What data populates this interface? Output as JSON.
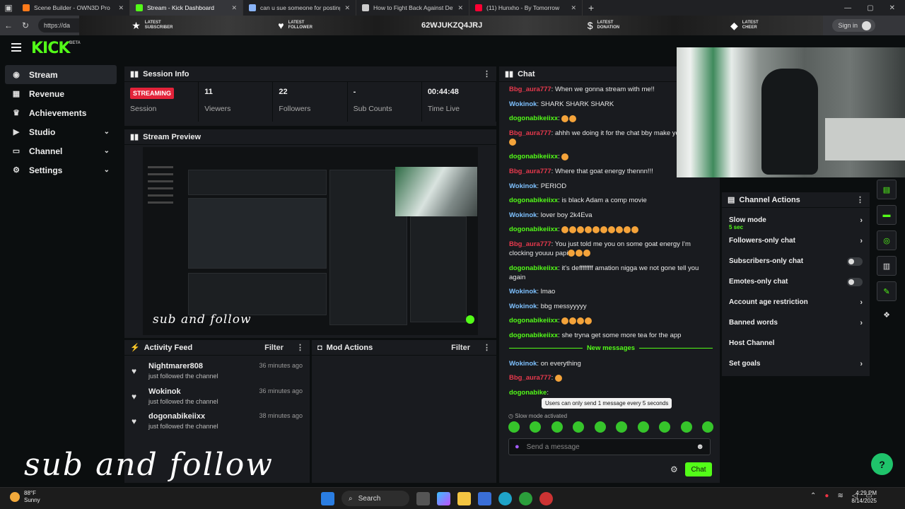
{
  "browser": {
    "tabs": [
      {
        "title": "Scene Builder - OWN3D Pro",
        "color": "#ff7a1a"
      },
      {
        "title": "Stream - Kick Dashboard",
        "color": "#53fc18"
      },
      {
        "title": "can u sue someone for posting y",
        "color": "#8ab4f8"
      },
      {
        "title": "How to Fight Back Against Defan",
        "color": "#cccccc"
      },
      {
        "title": "(11) Hunxho - By Tomorrow",
        "color": "#ff0033"
      }
    ],
    "url": "https://da",
    "signin": "Sign in"
  },
  "banner": {
    "items": [
      {
        "icon": "★",
        "label": "LATEST SUBSCRIBER"
      },
      {
        "icon": "♥",
        "label": "LATEST FOLLOWER"
      },
      {
        "icon": "$",
        "label": "LATEST DONATION"
      },
      {
        "icon": "◆",
        "label": "LATEST CHEER"
      }
    ],
    "code": "62WJUKZQ4JRJ"
  },
  "kick": {
    "logo": "KICK",
    "beta": "BETA"
  },
  "sidebar": {
    "items": [
      {
        "label": "Stream",
        "icon": "broadcast-icon",
        "glyph": "◉"
      },
      {
        "label": "Revenue",
        "icon": "chart-icon",
        "glyph": "▦"
      },
      {
        "label": "Achievements",
        "icon": "trophy-icon",
        "glyph": "♛"
      },
      {
        "label": "Studio",
        "icon": "video-icon",
        "glyph": "▶"
      },
      {
        "label": "Channel",
        "icon": "tv-icon",
        "glyph": "▭"
      },
      {
        "label": "Settings",
        "icon": "gear-icon",
        "glyph": "⚙"
      }
    ]
  },
  "session": {
    "title": "Session Info",
    "status": "STREAMING",
    "stats": [
      {
        "value": "",
        "label": "Session"
      },
      {
        "value": "11",
        "label": "Viewers"
      },
      {
        "value": "22",
        "label": "Followers"
      },
      {
        "value": "-",
        "label": "Sub Counts"
      },
      {
        "value": "00:44:48",
        "label": "Time Live"
      }
    ]
  },
  "preview": {
    "title": "Stream Preview",
    "caption": "sub and follow"
  },
  "activity": {
    "title": "Activity Feed",
    "filter": "Filter",
    "items": [
      {
        "name": "Nightmarer808",
        "action": "just followed the channel",
        "time": "36 minutes ago"
      },
      {
        "name": "Wokinok",
        "action": "just followed the channel",
        "time": "36 minutes ago"
      },
      {
        "name": "dogonabikeiixx",
        "action": "just followed the channel",
        "time": "38 minutes ago"
      }
    ]
  },
  "mod": {
    "title": "Mod Actions",
    "filter": "Filter"
  },
  "chat": {
    "title": "Chat",
    "messages": [
      {
        "user": "Bbg_aura777",
        "color": "red",
        "text": "When we gonna stream with me!!",
        "emotes": 0
      },
      {
        "user": "Wokinok",
        "color": "blue",
        "text": "SHARK SHARK SHARK",
        "emotes": 0
      },
      {
        "user": "dogonabikeiixx",
        "color": "green",
        "text": "",
        "emotes": 2
      },
      {
        "user": "Bbg_aura777",
        "color": "red",
        "text": "ahhh we doing it for the chat bby make you",
        "emotes": 4
      },
      {
        "user": "dogonabikeiixx",
        "color": "green",
        "text": "",
        "emotes": 1
      },
      {
        "user": "Bbg_aura777",
        "color": "red",
        "text": "Where that goat energy thennn!!!",
        "emotes": 0
      },
      {
        "user": "Wokinok",
        "color": "blue",
        "text": "PERIOD",
        "emotes": 0
      },
      {
        "user": "dogonabikeiixx",
        "color": "green",
        "text": "is black Adam a comp movie",
        "emotes": 0
      },
      {
        "user": "Wokinok",
        "color": "blue",
        "text": "lover boy 2k4Eva",
        "emotes": 0
      },
      {
        "user": "dogonabikeiixx",
        "color": "green",
        "text": "",
        "emotes": 10
      },
      {
        "user": "Bbg_aura777",
        "color": "red",
        "text": "You just told me you on some goat energy I'm clocking youuu papi",
        "emotes": 3
      },
      {
        "user": "dogonabikeiixx",
        "color": "green",
        "text": "it's deffffffff amation nigga we not gone tell you again",
        "emotes": 0
      },
      {
        "user": "Wokinok",
        "color": "blue",
        "text": "lmao",
        "emotes": 0
      },
      {
        "user": "Wokinok",
        "color": "blue",
        "text": "bbg messyyyyy",
        "emotes": 0
      },
      {
        "user": "dogonabikeiixx",
        "color": "green",
        "text": "",
        "emotes": 4
      },
      {
        "user": "dogonabikeiixx",
        "color": "green",
        "text": "she tryna get some more tea for the app",
        "emotes": 0
      }
    ],
    "divider": "New messages",
    "new_messages": [
      {
        "user": "Wokinok",
        "color": "blue",
        "text": "on everything",
        "emotes": 0
      },
      {
        "user": "Bbg_aura777",
        "color": "red",
        "text": "",
        "emotes": 1
      },
      {
        "user": "dogonabike",
        "color": "green",
        "text": "",
        "emotes": 0
      }
    ],
    "tooltip": "Users can only send 1 message every 5 seconds",
    "slow_mode": "Slow mode activated",
    "placeholder": "Send a message",
    "send": "Chat"
  },
  "actions": {
    "title": "Channel Actions",
    "items": [
      {
        "label": "Slow mode",
        "sub": "5 sec",
        "control": "chevron"
      },
      {
        "label": "Followers-only chat",
        "sub": "",
        "control": "chevron"
      },
      {
        "label": "Subscribers-only chat",
        "sub": "",
        "control": "toggle"
      },
      {
        "label": "Emotes-only chat",
        "sub": "",
        "control": "toggle"
      },
      {
        "label": "Account age restriction",
        "sub": "",
        "control": "chevron"
      },
      {
        "label": "Banned words",
        "sub": "",
        "control": "chevron"
      },
      {
        "label": "Host Channel",
        "sub": "",
        "control": "none"
      },
      {
        "label": "Set goals",
        "sub": "",
        "control": "chevron"
      }
    ]
  },
  "overlay_caption": "sub and follow",
  "taskbar": {
    "temp": "88°F",
    "condition": "Sunny",
    "search": "Search",
    "time": "4:29 PM",
    "date": "8/14/2025"
  },
  "colors": {
    "accent": "#53fc18",
    "live": "#e3233a",
    "panel": "#191b1f",
    "bg": "#0b0e0f"
  }
}
